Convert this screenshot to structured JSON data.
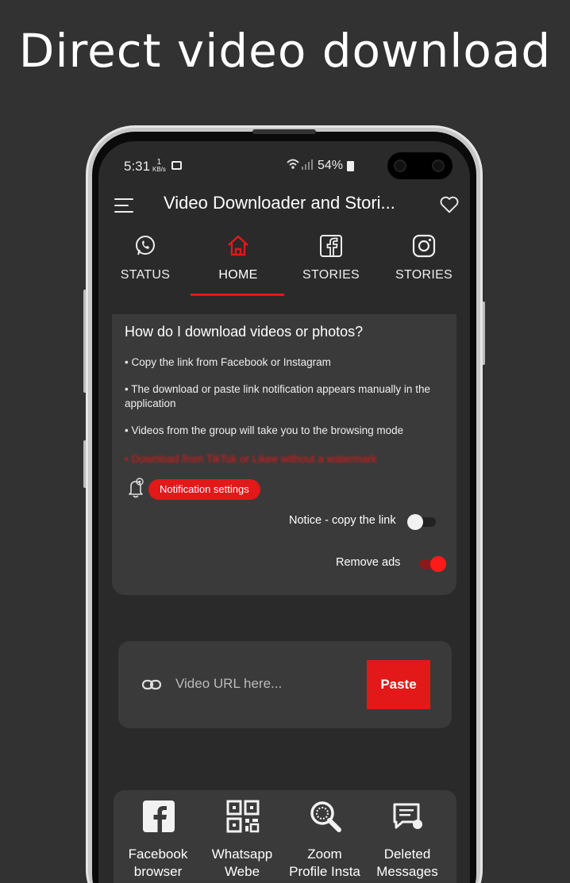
{
  "headline": "Direct video download",
  "status_bar": {
    "time": "5:31",
    "speed_value": "1",
    "speed_unit": "KB/s",
    "battery": "54%"
  },
  "app_bar": {
    "title": "Video Downloader and Stori..."
  },
  "tabs": [
    {
      "label": "STATUS",
      "icon": "whatsapp-icon",
      "active": false
    },
    {
      "label": "HOME",
      "icon": "home-icon",
      "active": true
    },
    {
      "label": "STORIES",
      "icon": "facebook-icon",
      "active": false
    },
    {
      "label": "STORIES",
      "icon": "instagram-icon",
      "active": false
    }
  ],
  "info_card": {
    "title": "How do I download videos or photos?",
    "bullets": [
      "• Copy the link from Facebook or Instagram",
      "• The download or paste link notification appears manually in the application",
      "• Videos from the group will take you to the browsing mode",
      "• Download from TikTok or Likee without a watermark"
    ],
    "notification_button": "Notification settings",
    "toggles": [
      {
        "label": "Notice - copy the link",
        "on": false
      },
      {
        "label": "Remove ads",
        "on": true
      }
    ]
  },
  "url_card": {
    "placeholder": "Video URL here...",
    "paste_label": "Paste"
  },
  "shortcuts": [
    {
      "line1": "Facebook",
      "line2": "browser",
      "icon": "facebook-icon"
    },
    {
      "line1": "Whatsapp",
      "line2": "Webe",
      "icon": "qr-code-icon"
    },
    {
      "line1": "Zoom",
      "line2": "Profile Insta",
      "icon": "zoom-icon"
    },
    {
      "line1": "Deleted",
      "line2": "Messages",
      "icon": "deleted-messages-icon"
    }
  ],
  "colors": {
    "accent": "#e31818",
    "background": "#323232",
    "screen": "#2a2a2a",
    "card": "#3a3a3a"
  }
}
